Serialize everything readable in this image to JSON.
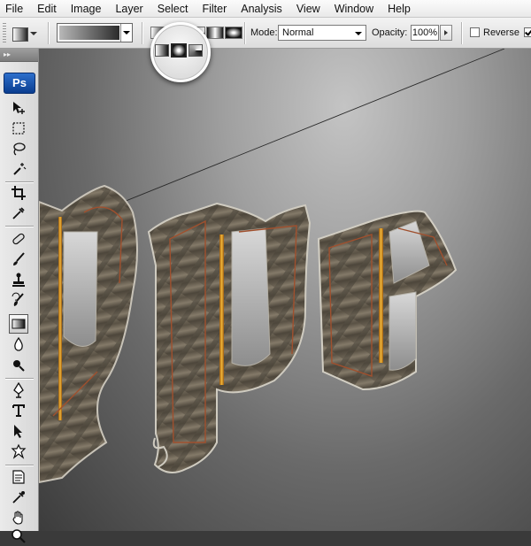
{
  "menu": {
    "items": [
      "File",
      "Edit",
      "Image",
      "Layer",
      "Select",
      "Filter",
      "Analysis",
      "View",
      "Window",
      "Help"
    ]
  },
  "options_bar": {
    "tool": "gradient-tool",
    "gradient_types": [
      "linear",
      "radial",
      "angle",
      "reflected",
      "diamond"
    ],
    "selected_gradient_type": "radial",
    "mode_label": "Mode:",
    "mode_value": "Normal",
    "opacity_label": "Opacity:",
    "opacity_value": "100%",
    "reverse_label": "Reverse",
    "reverse_checked": false,
    "dither_checked": true
  },
  "toolbox": {
    "logo": "Ps",
    "tools": [
      "move-tool",
      "marquee-tool",
      "lasso-tool",
      "magic-wand-tool",
      "crop-tool",
      "eyedropper-tool",
      "healing-brush-tool",
      "brush-tool",
      "clone-stamp-tool",
      "history-brush-tool",
      "eraser-tool",
      "gradient-tool",
      "blur-tool",
      "dodge-tool",
      "pen-tool",
      "type-tool",
      "path-selection-tool",
      "custom-shape-tool",
      "notes-tool",
      "eyedropper-tool-2",
      "hand-tool",
      "zoom-tool"
    ],
    "active_tool": "gradient-tool"
  },
  "colors": {
    "accent_blue": "#1a56b8",
    "metal_dark": "#4a4338",
    "metal_light": "#8a8070",
    "gold": "#d89a2a",
    "copper_outline": "#9a4a2a"
  }
}
